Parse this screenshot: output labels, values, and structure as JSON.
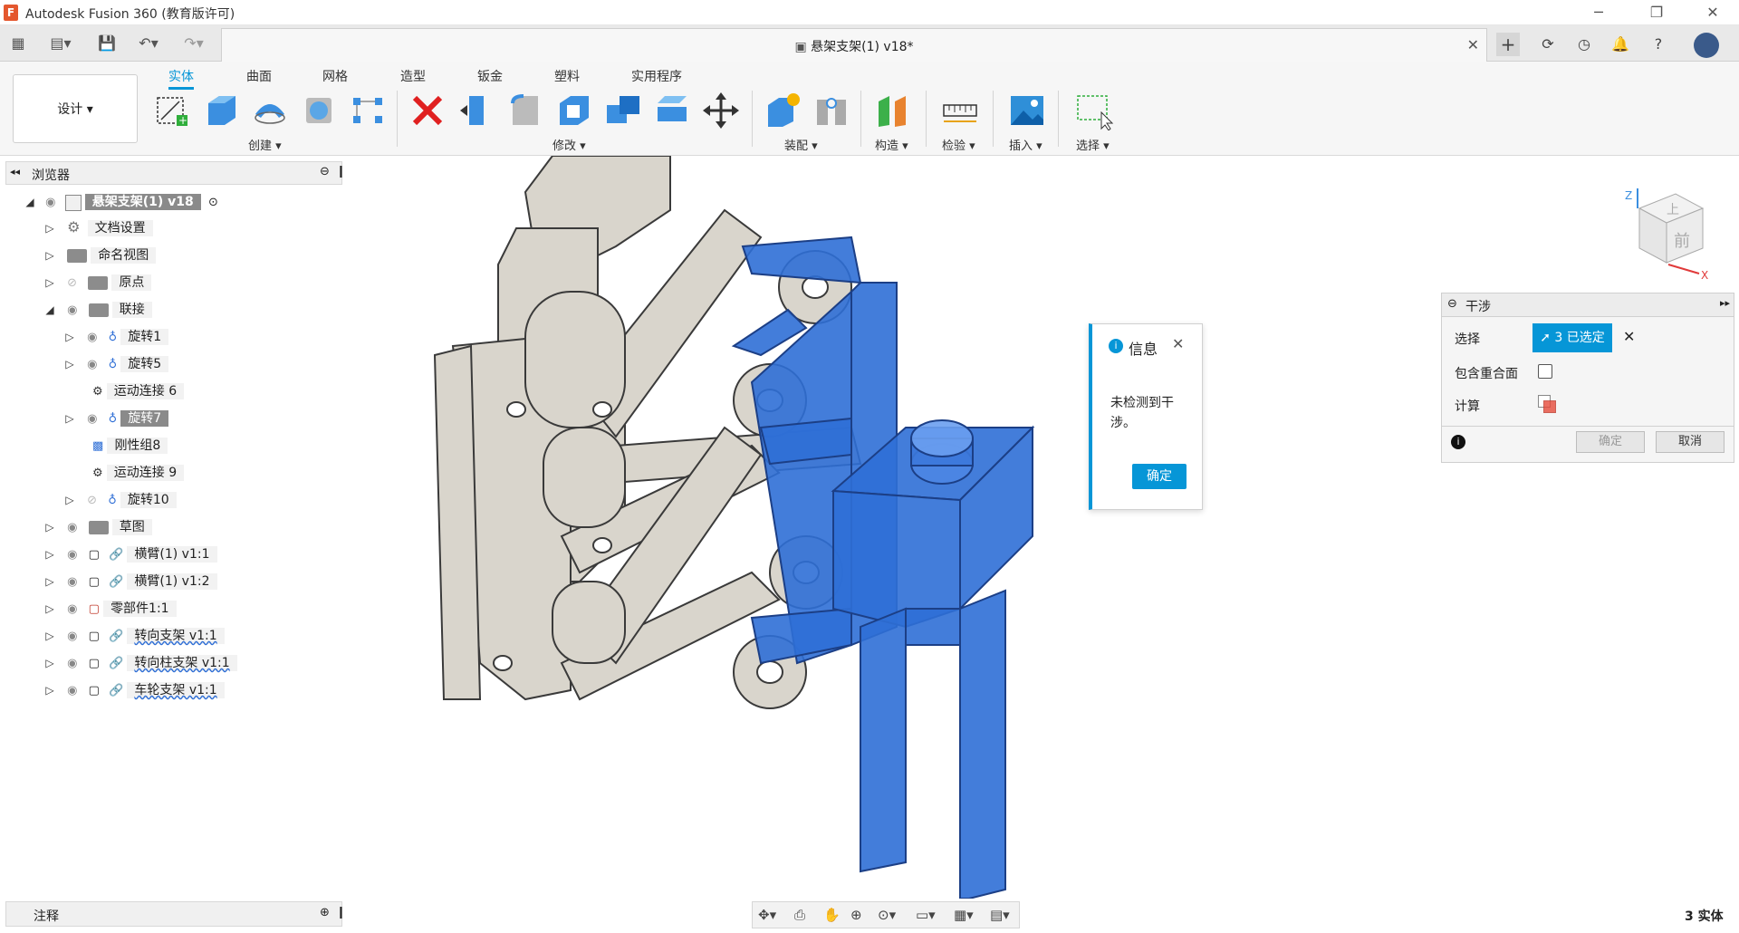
{
  "window": {
    "logo_letter": "F",
    "title": "Autodesk Fusion 360 (教育版许可)",
    "minimize": "─",
    "restore": "❐",
    "close": "✕"
  },
  "tabbar": {
    "doc_title": "悬架支架(1) v18*",
    "doc_close": "✕",
    "plus": "+"
  },
  "ribbon": {
    "design_label": "设计 ▾",
    "tabs": [
      "实体",
      "曲面",
      "网格",
      "造型",
      "钣金",
      "塑料",
      "实用程序"
    ],
    "groups": [
      "创建 ▾",
      "修改 ▾",
      "装配 ▾",
      "构造 ▾",
      "检验 ▾",
      "插入 ▾",
      "选择 ▾"
    ]
  },
  "browser": {
    "title": "浏览器",
    "root": "悬架支架(1) v18",
    "items": [
      {
        "label": "文档设置"
      },
      {
        "label": "命名视图"
      },
      {
        "label": "原点"
      },
      {
        "label": "联接"
      },
      {
        "label": "旋转1"
      },
      {
        "label": "旋转5"
      },
      {
        "label": "运动连接 6"
      },
      {
        "label": "旋转7"
      },
      {
        "label": "刚性组8"
      },
      {
        "label": "运动连接 9"
      },
      {
        "label": "旋转10"
      },
      {
        "label": "草图"
      },
      {
        "label": "横臂(1) v1:1"
      },
      {
        "label": "横臂(1) v1:2"
      },
      {
        "label": "零部件1:1"
      },
      {
        "label": "转向支架 v1:1"
      },
      {
        "label": "转向柱支架 v1:1"
      },
      {
        "label": "车轮支架 v1:1"
      }
    ]
  },
  "info_dialog": {
    "title": "信息",
    "message": "未检测到干涉。",
    "ok": "确定"
  },
  "interference": {
    "title": "干涉",
    "select_label": "选择",
    "selected": "3 已选定",
    "overlap_label": "包含重合面",
    "compute_label": "计算",
    "ok": "确定",
    "cancel": "取消"
  },
  "viewcube": {
    "face": "前",
    "top_face": "上",
    "x": "X",
    "z": "Z"
  },
  "comments": {
    "label": "注释"
  },
  "status": {
    "bodies": "3 实体"
  },
  "colors": {
    "accent": "#0696d7",
    "selected_body": "#2f6fd6",
    "part": "#d9d5cc"
  }
}
